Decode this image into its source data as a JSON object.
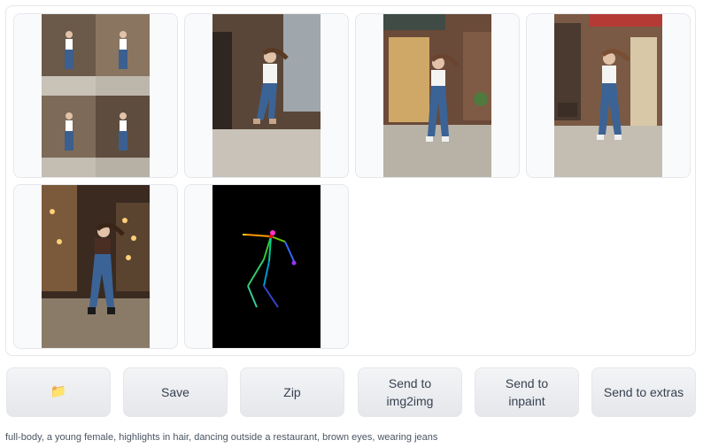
{
  "gallery": {
    "images": [
      {
        "name": "grid-of-four-jump-photos"
      },
      {
        "name": "jumping-woman-street-photo-1"
      },
      {
        "name": "jumping-woman-storefront-photo-2"
      },
      {
        "name": "jumping-woman-cafe-photo-3"
      },
      {
        "name": "jumping-woman-night-street-photo-4"
      },
      {
        "name": "openpose-skeleton-map"
      }
    ]
  },
  "toolbar": {
    "folder_icon": "📁",
    "save_label": "Save",
    "zip_label": "Zip",
    "send_img2img_label": "Send to\nimg2img",
    "send_inpaint_label": "Send to\ninpaint",
    "send_extras_label": "Send to extras"
  },
  "caption": "full-body, a young female, highlights in hair, dancing outside a restaurant, brown eyes, wearing jeans",
  "colors": {
    "button_bg": "#e5e7eb",
    "border": "#e5e7eb",
    "text": "#374151",
    "folder": "#f5c518"
  }
}
